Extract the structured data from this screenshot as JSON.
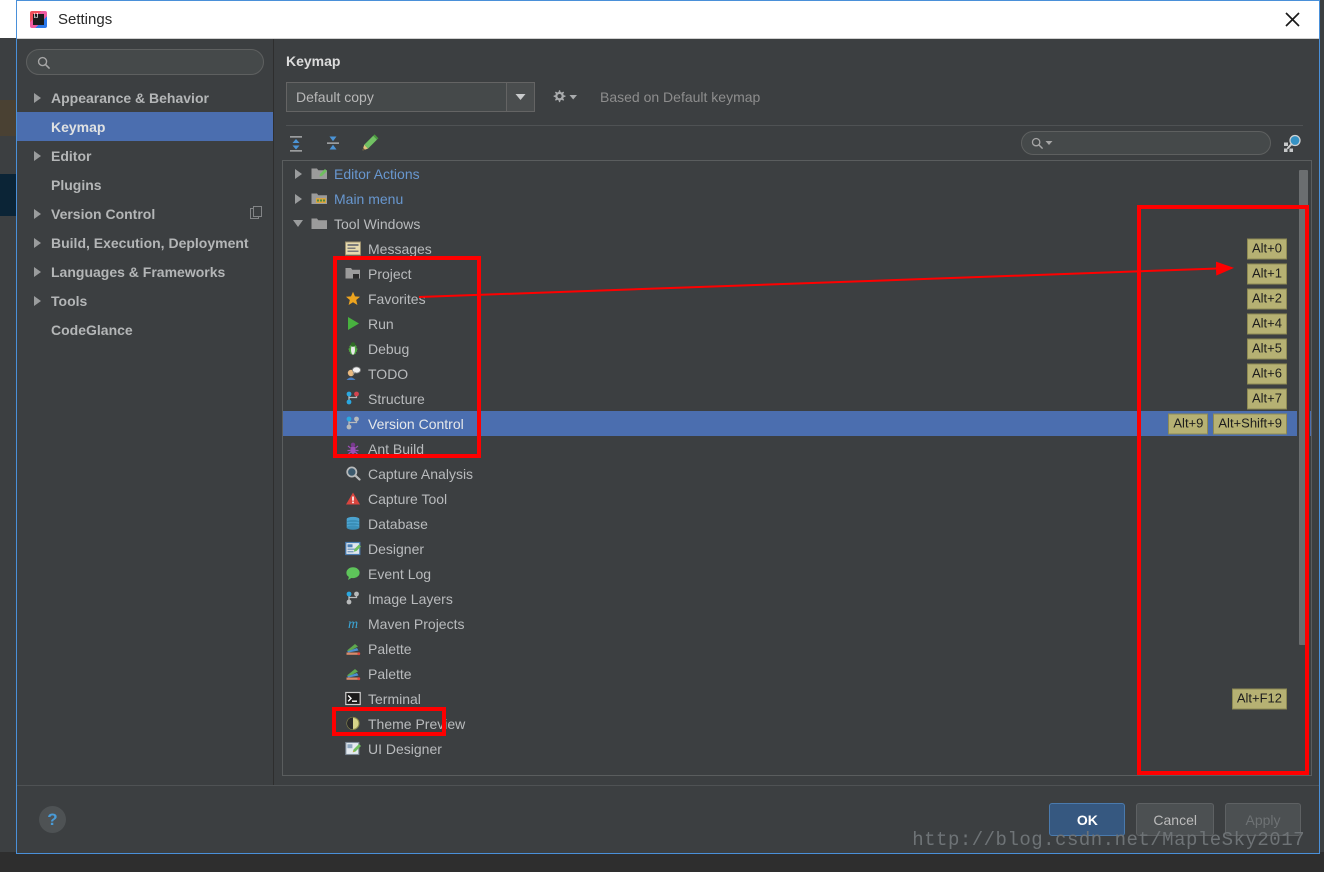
{
  "window": {
    "title": "Settings",
    "app_icon": "intellij-idea-icon",
    "close_icon": "close-icon",
    "border_color": "#4a90d9"
  },
  "sidebar": {
    "search": {
      "value": "",
      "placeholder": "",
      "icon": "search-icon"
    },
    "items": [
      {
        "label": "Appearance & Behavior",
        "expandable": true,
        "selected": false,
        "badge": null
      },
      {
        "label": "Keymap",
        "expandable": false,
        "selected": true,
        "badge": null
      },
      {
        "label": "Editor",
        "expandable": true,
        "selected": false,
        "badge": null
      },
      {
        "label": "Plugins",
        "expandable": false,
        "selected": false,
        "badge": null
      },
      {
        "label": "Version Control",
        "expandable": true,
        "selected": false,
        "badge": "copy-icon"
      },
      {
        "label": "Build, Execution, Deployment",
        "expandable": true,
        "selected": false,
        "badge": null
      },
      {
        "label": "Languages & Frameworks",
        "expandable": true,
        "selected": false,
        "badge": null
      },
      {
        "label": "Tools",
        "expandable": true,
        "selected": false,
        "badge": null
      },
      {
        "label": "CodeGlance",
        "expandable": false,
        "selected": false,
        "badge": null
      }
    ]
  },
  "content": {
    "panel_title": "Keymap",
    "keymap_select": {
      "value": "Default copy",
      "arrow_icon": "chevron-down-icon"
    },
    "gear_icon": "gear-icon",
    "based_on": "Based on Default keymap",
    "toolbar": [
      {
        "name": "expand-all-icon",
        "tooltip": "Expand All"
      },
      {
        "name": "collapse-all-icon",
        "tooltip": "Collapse All"
      },
      {
        "name": "edit-shortcut-icon",
        "tooltip": "Edit Shortcut"
      }
    ],
    "search": {
      "value": "",
      "placeholder": "",
      "icon": "search-icon"
    },
    "find_by_shortcut_icon": "find-by-shortcut-icon"
  },
  "tree": {
    "rows": [
      {
        "label": "Editor Actions",
        "icon": "editor-actions-folder-icon",
        "depth": 1,
        "arrow": "collapsed",
        "link": true,
        "selected": false,
        "shortcuts": []
      },
      {
        "label": "Main menu",
        "icon": "main-menu-folder-icon",
        "depth": 1,
        "arrow": "collapsed",
        "link": true,
        "selected": false,
        "shortcuts": []
      },
      {
        "label": "Tool Windows",
        "icon": "folder-icon",
        "depth": 1,
        "arrow": "expanded",
        "link": false,
        "selected": false,
        "shortcuts": []
      },
      {
        "label": "Messages",
        "icon": "messages-icon",
        "depth": 2,
        "arrow": "none",
        "link": false,
        "selected": false,
        "shortcuts": [
          "Alt+0"
        ]
      },
      {
        "label": "Project",
        "icon": "project-icon",
        "depth": 2,
        "arrow": "none",
        "link": false,
        "selected": false,
        "shortcuts": [
          "Alt+1"
        ]
      },
      {
        "label": "Favorites",
        "icon": "favorites-star-icon",
        "depth": 2,
        "arrow": "none",
        "link": false,
        "selected": false,
        "shortcuts": [
          "Alt+2"
        ]
      },
      {
        "label": "Run",
        "icon": "run-play-icon",
        "depth": 2,
        "arrow": "none",
        "link": false,
        "selected": false,
        "shortcuts": [
          "Alt+4"
        ]
      },
      {
        "label": "Debug",
        "icon": "debug-bug-icon",
        "depth": 2,
        "arrow": "none",
        "link": false,
        "selected": false,
        "shortcuts": [
          "Alt+5"
        ]
      },
      {
        "label": "TODO",
        "icon": "todo-icon",
        "depth": 2,
        "arrow": "none",
        "link": false,
        "selected": false,
        "shortcuts": [
          "Alt+6"
        ]
      },
      {
        "label": "Structure",
        "icon": "structure-icon",
        "depth": 2,
        "arrow": "none",
        "link": false,
        "selected": false,
        "shortcuts": [
          "Alt+7"
        ]
      },
      {
        "label": "Version Control",
        "icon": "version-control-icon",
        "depth": 2,
        "arrow": "none",
        "link": false,
        "selected": true,
        "shortcuts": [
          "Alt+9",
          "Alt+Shift+9"
        ]
      },
      {
        "label": "Ant Build",
        "icon": "ant-build-icon",
        "depth": 2,
        "arrow": "none",
        "link": false,
        "selected": false,
        "shortcuts": []
      },
      {
        "label": "Capture Analysis",
        "icon": "capture-analysis-icon",
        "depth": 2,
        "arrow": "none",
        "link": false,
        "selected": false,
        "shortcuts": []
      },
      {
        "label": "Capture Tool",
        "icon": "capture-tool-icon",
        "depth": 2,
        "arrow": "none",
        "link": false,
        "selected": false,
        "shortcuts": []
      },
      {
        "label": "Database",
        "icon": "database-icon",
        "depth": 2,
        "arrow": "none",
        "link": false,
        "selected": false,
        "shortcuts": []
      },
      {
        "label": "Designer",
        "icon": "designer-icon",
        "depth": 2,
        "arrow": "none",
        "link": false,
        "selected": false,
        "shortcuts": []
      },
      {
        "label": "Event Log",
        "icon": "event-log-icon",
        "depth": 2,
        "arrow": "none",
        "link": false,
        "selected": false,
        "shortcuts": []
      },
      {
        "label": "Image Layers",
        "icon": "image-layers-icon",
        "depth": 2,
        "arrow": "none",
        "link": false,
        "selected": false,
        "shortcuts": []
      },
      {
        "label": "Maven Projects",
        "icon": "maven-icon",
        "depth": 2,
        "arrow": "none",
        "link": false,
        "selected": false,
        "shortcuts": []
      },
      {
        "label": "Palette",
        "icon": "palette-icon",
        "depth": 2,
        "arrow": "none",
        "link": false,
        "selected": false,
        "shortcuts": []
      },
      {
        "label": "Palette",
        "icon": "palette-icon",
        "depth": 2,
        "arrow": "none",
        "link": false,
        "selected": false,
        "shortcuts": []
      },
      {
        "label": "Terminal",
        "icon": "terminal-icon",
        "depth": 2,
        "arrow": "none",
        "link": false,
        "selected": false,
        "shortcuts": [
          "Alt+F12"
        ]
      },
      {
        "label": "Theme Preview",
        "icon": "theme-preview-icon",
        "depth": 2,
        "arrow": "none",
        "link": false,
        "selected": false,
        "shortcuts": []
      },
      {
        "label": "UI Designer",
        "icon": "ui-designer-icon",
        "depth": 2,
        "arrow": "none",
        "link": false,
        "selected": false,
        "shortcuts": []
      }
    ]
  },
  "footer": {
    "help_label": "?",
    "ok_label": "OK",
    "cancel_label": "Cancel",
    "apply_label": "Apply",
    "apply_disabled": true,
    "watermark": "http://blog.csdn.net/MapleSky2017"
  },
  "annotations": {
    "color": "#fe0000",
    "boxes": [
      {
        "name": "tool-windows-group-highlight"
      },
      {
        "name": "shortcuts-column-highlight"
      },
      {
        "name": "terminal-row-highlight"
      }
    ],
    "arrow": {
      "name": "project-to-shortcut-arrow"
    }
  }
}
